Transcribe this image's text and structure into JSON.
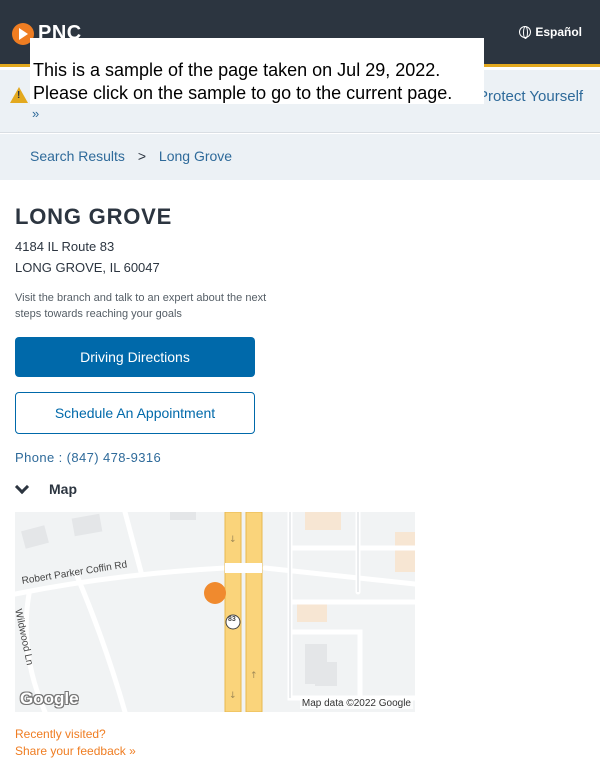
{
  "header": {
    "logo_text": "PNC",
    "language_link": "Español"
  },
  "alert": {
    "link_text": "Protect Yourself",
    "more_glyph": "»"
  },
  "overlay": {
    "line1": "This is a sample of the page taken on Jul 29, 2022.",
    "line2": "Please click on the sample to go to the current page."
  },
  "breadcrumb": {
    "items": [
      "Search Results",
      "Long Grove"
    ],
    "separator": ">"
  },
  "branch": {
    "name": "LONG GROVE",
    "address_line1": "4184 IL Route 83",
    "address_line2": "LONG GROVE, IL 60047",
    "description": "Visit the branch and talk to an expert about the next steps towards reaching your goals",
    "directions_button": "Driving Directions",
    "appointment_button": "Schedule An Appointment",
    "phone": "Phone : (847) 478-9316"
  },
  "map": {
    "section_label": "Map",
    "road_name_1": "Robert Parker Coffin Rd",
    "road_name_2": "Wildwood Ln",
    "route_marker": "83",
    "logo_text": "Google",
    "credit": "Map data ©2022 Google"
  },
  "footer": {
    "recently_visited": "Recently visited?",
    "feedback": "Share your feedback »"
  },
  "colors": {
    "brand_orange": "#ef7d22",
    "header_dark": "#2c3540",
    "button_blue": "#0069aa",
    "link_blue": "#2e6a9a"
  }
}
